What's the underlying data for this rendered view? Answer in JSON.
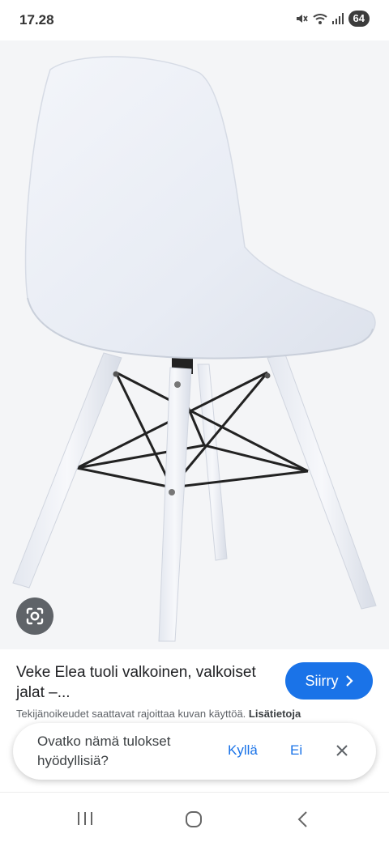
{
  "status_bar": {
    "time": "17.28",
    "battery": "64"
  },
  "image": {
    "icons": [
      "google-lens-icon"
    ]
  },
  "result": {
    "title": "Veke Elea tuoli valkoinen, valkoiset jalat –...",
    "visit_label": "Siirry",
    "copyright_notice": "Tekijänoikeudet saattavat rajoittaa kuvan käyttöä.",
    "learn_more": "Lisätietoja"
  },
  "feedback": {
    "question": "Ovatko nämä tulokset hyödyllisiä?",
    "yes_label": "Kyllä",
    "no_label": "Ei"
  },
  "nav_bar": {
    "icons": [
      "recent-apps-icon",
      "home-icon",
      "back-icon"
    ]
  },
  "colors": {
    "accent": "#1a73e8",
    "image_background": "#f4f5f7"
  }
}
